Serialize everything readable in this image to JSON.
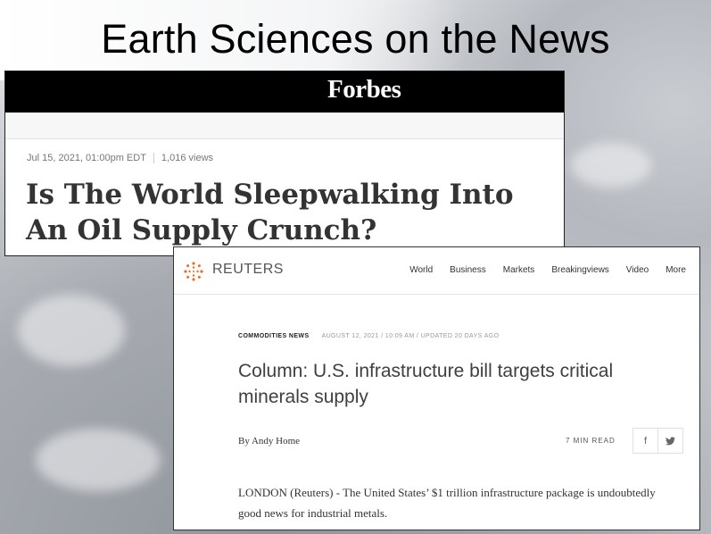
{
  "slide": {
    "title": "Earth Sciences on the News"
  },
  "forbes": {
    "logo": "Forbes",
    "date": "Jul 15, 2021, 01:00pm EDT",
    "views": "1,016 views",
    "headline": "Is The World Sleepwalking Into An Oil Supply Crunch?"
  },
  "reuters": {
    "brand": "REUTERS",
    "nav": [
      "World",
      "Business",
      "Markets",
      "Breakingviews",
      "Video",
      "More"
    ],
    "category": "COMMODITIES NEWS",
    "dateline": "AUGUST 12, 2021 / 10:09 AM / UPDATED 20 DAYS AGO",
    "headline": "Column: U.S. infrastructure bill targets critical minerals supply",
    "byline": "By Andy Home",
    "read_time": "7 MIN READ",
    "share": {
      "facebook_icon": "f",
      "twitter_icon": "🐦"
    },
    "body": "LONDON (Reuters) - The United States’ $1 trillion infrastructure package is undoubtedly good news for industrial metals."
  },
  "colors": {
    "forbes_bar": "#000000",
    "reuters_orange": "#f26a21"
  }
}
